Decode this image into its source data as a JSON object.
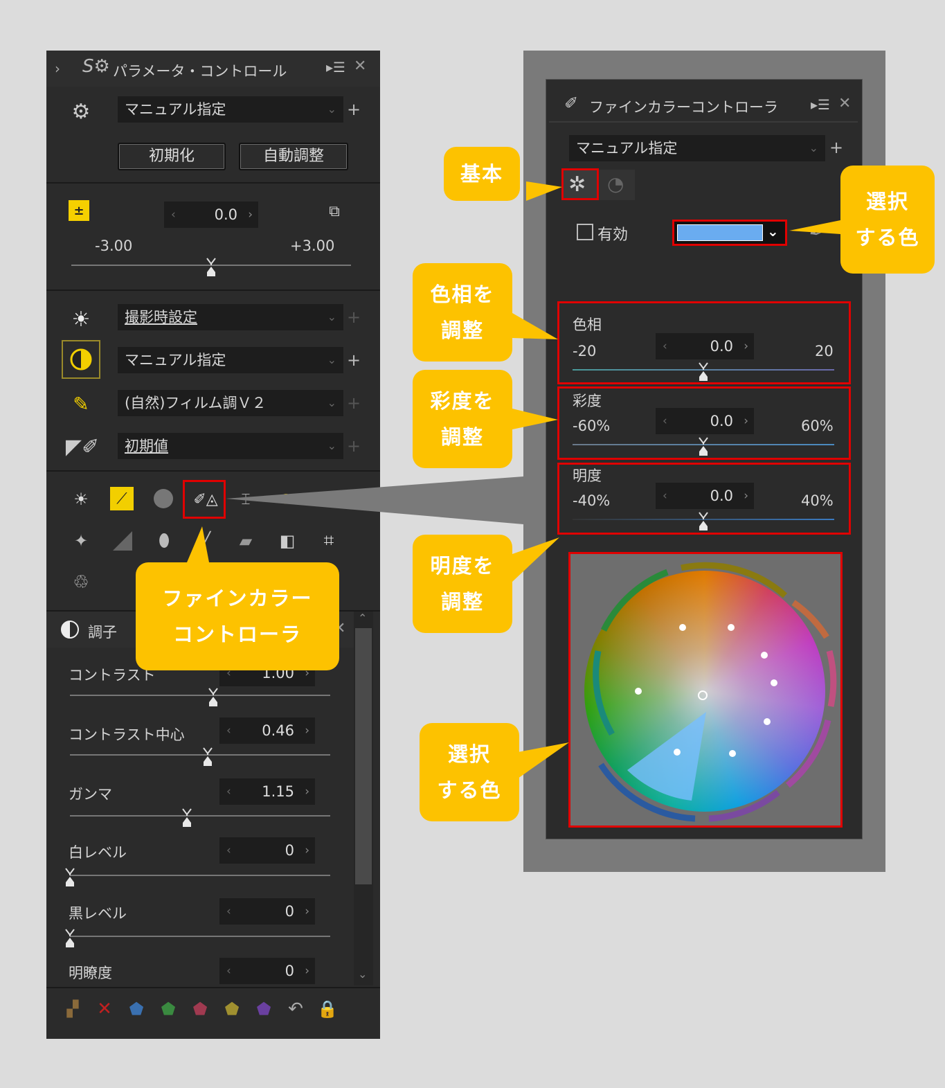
{
  "param_panel": {
    "title": "パラメータ・コントロール",
    "preset": "マニュアル指定",
    "reset_label": "初期化",
    "auto_label": "自動調整",
    "exposure": {
      "value": "0.0",
      "min": "-3.00",
      "max": "+3.00",
      "level": 0.5
    },
    "rows": [
      {
        "label": "撮影時設定"
      },
      {
        "label": "マニュアル指定"
      },
      {
        "label": "(自然)フィルム調Ｖ２"
      },
      {
        "label": "初期値"
      }
    ]
  },
  "tone_panel": {
    "title": "調子",
    "contrast": {
      "label": "コントラスト",
      "value": "1.00",
      "level": 0.55
    },
    "contrast_center": {
      "label": "コントラスト中心",
      "value": "0.46",
      "level": 0.53
    },
    "gamma": {
      "label": "ガンマ",
      "value": "1.15",
      "level": 0.45
    },
    "white": {
      "label": "白レベル",
      "value": "0",
      "level": 0.0
    },
    "black": {
      "label": "黒レベル",
      "value": "0",
      "level": 0.0
    },
    "clarity": {
      "label": "明瞭度",
      "value": "0"
    }
  },
  "fine_panel": {
    "title": "ファインカラーコントローラ",
    "preset": "マニュアル指定",
    "enable_label": "有効",
    "selected_color": "#6aacf0",
    "hue": {
      "label": "色相",
      "min": "-20",
      "max": "20",
      "value": "0.0",
      "level": 0.5
    },
    "saturation": {
      "label": "彩度",
      "min": "-60%",
      "max": "60%",
      "value": "0.0",
      "level": 0.5
    },
    "brightness": {
      "label": "明度",
      "min": "-40%",
      "max": "40%",
      "value": "0.0",
      "level": 0.5
    }
  },
  "callouts": {
    "basic": "基本",
    "select_color_line1": "選択",
    "select_color_line2": "する色",
    "hue_line1": "色相を",
    "hue_line2": "調整",
    "sat_line1": "彩度を",
    "sat_line2": "調整",
    "bright_line1": "明度を",
    "bright_line2": "調整",
    "wheel_line1": "選択",
    "wheel_line2": "する色",
    "fcc_line1": "ファインカラー",
    "fcc_line2": "コントローラ"
  },
  "colors": {
    "callout": "#fdc200",
    "highlight": "#e00000",
    "panel": "#2b2b2b"
  }
}
